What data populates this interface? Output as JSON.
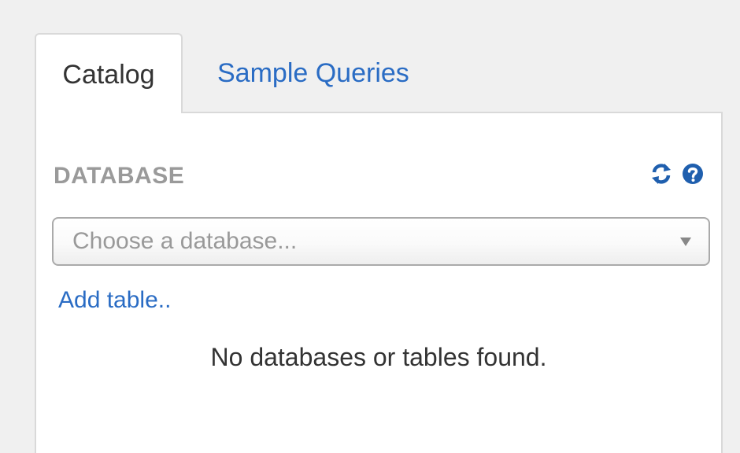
{
  "tabs": [
    {
      "label": "Catalog",
      "active": true
    },
    {
      "label": "Sample Queries",
      "active": false
    }
  ],
  "section": {
    "title": "DATABASE",
    "icons": [
      "refresh-icon",
      "help-icon"
    ]
  },
  "database_select": {
    "placeholder": "Choose a database..."
  },
  "add_table_link": "Add table..",
  "empty_message": "No databases or tables found.",
  "colors": {
    "link": "#2a6cc4",
    "icon": "#1f5fae",
    "section_title": "#9a9a9a",
    "placeholder": "#999999"
  }
}
